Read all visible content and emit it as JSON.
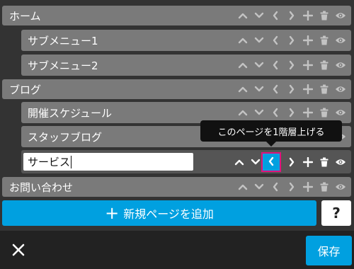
{
  "menu": {
    "items": [
      {
        "label": "ホーム"
      },
      {
        "label": "サブメニュー1"
      },
      {
        "label": "サブメニュー2"
      },
      {
        "label": "ブログ"
      },
      {
        "label": "開催スケジュール"
      },
      {
        "label": "スタッフブログ"
      },
      {
        "label": "サービス"
      },
      {
        "label": "お問い合わせ"
      }
    ]
  },
  "tooltip": {
    "text": "このページを1階層上げる"
  },
  "icons": {
    "up": "chevron-up-icon",
    "down": "chevron-down-icon",
    "left": "chevron-left-icon",
    "right": "chevron-right-icon",
    "add": "plus-icon",
    "delete": "trash-icon",
    "visible": "eye-icon"
  },
  "add_page_label": "新規ページを追加",
  "help_label": "?",
  "save_label": "保存",
  "colors": {
    "accent": "#00a0e0",
    "highlight": "#e1137d",
    "row": "#7a7a7a",
    "background": "#333333"
  }
}
